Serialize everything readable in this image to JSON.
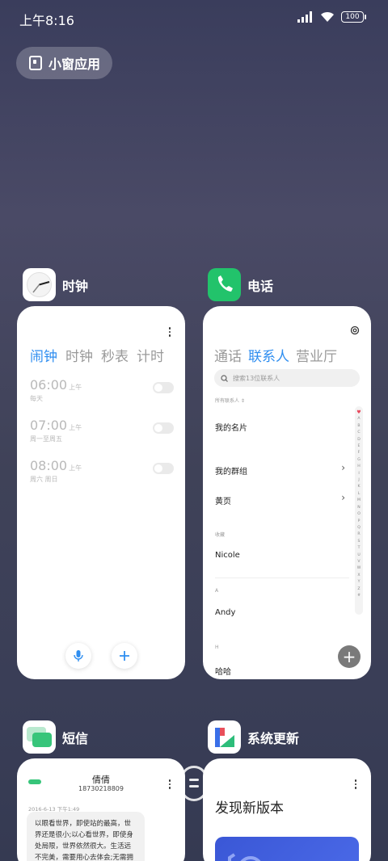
{
  "status_bar": {
    "time": "上午8:16",
    "battery": "100"
  },
  "small_window": {
    "label": "小窗应用"
  },
  "clock_app": {
    "name": "时钟",
    "tabs": [
      "闹钟",
      "时钟",
      "秒表",
      "计时"
    ],
    "alarms": [
      {
        "time": "06:00",
        "ampm": "上午",
        "repeat": "每天"
      },
      {
        "time": "07:00",
        "ampm": "上午",
        "repeat": "周一至周五"
      },
      {
        "time": "08:00",
        "ampm": "上午",
        "repeat": "周六 周日"
      }
    ]
  },
  "phone_app": {
    "name": "电话",
    "tabs": [
      "通话",
      "联系人",
      "营业厅"
    ],
    "search_placeholder": "搜索13位联系人",
    "filter": "所有联系人",
    "my_card": "我的名片",
    "my_groups": "我的群组",
    "yellow_pages": "黄页",
    "favorites_label": "收藏",
    "contact_nicole": "Nicole",
    "section_a": "A",
    "contact_andy": "Andy",
    "section_h": "H",
    "contact_haha": "哈哈",
    "index_letters": [
      "A",
      "B",
      "C",
      "D",
      "E",
      "F",
      "G",
      "H",
      "I",
      "J",
      "K",
      "L",
      "M",
      "N",
      "O",
      "P",
      "Q",
      "R",
      "S",
      "T",
      "U",
      "V",
      "W",
      "X",
      "Y",
      "Z",
      "#"
    ]
  },
  "sms_app": {
    "name": "短信",
    "contact_name": "倩倩",
    "contact_number": "18730218809",
    "date": "2016-6-13 下午1:49",
    "message": "以眼看世界，即使站的最高，世界还是很小;以心看世界，即使身处局限，世界依然很大。生活远不完美，需要用心去体会;无需拥有太"
  },
  "update_app": {
    "name": "系统更新",
    "headline": "发现新版本"
  },
  "colors": {
    "accent": "#2f8ef0",
    "phone_green": "#22c36b"
  }
}
